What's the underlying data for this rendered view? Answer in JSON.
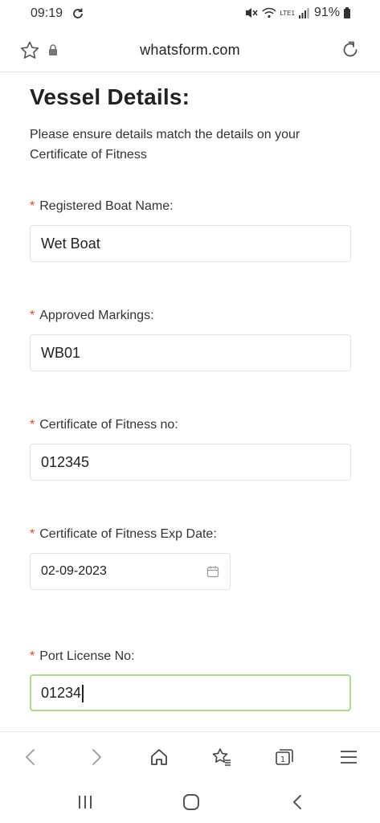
{
  "status_bar": {
    "time": "09:19",
    "battery_percent": "91%",
    "network_label": "LTE1",
    "icons": [
      "sync-icon",
      "mute-icon",
      "wifi-icon",
      "signal-icon",
      "battery-icon"
    ]
  },
  "browser": {
    "url": "whatsform.com",
    "icons": [
      "star-icon",
      "lock-icon",
      "reload-icon"
    ]
  },
  "form": {
    "title": "Vessel Details:",
    "description": "Please ensure details match the details on your Certificate of Fitness",
    "required_mark": "*",
    "fields": [
      {
        "label": "Registered Boat Name:",
        "value": "Wet Boat"
      },
      {
        "label": "Approved Markings:",
        "value": "WB01"
      },
      {
        "label": "Certificate of Fitness no:",
        "value": "012345"
      },
      {
        "label": "Certificate of Fitness Exp Date:",
        "value": "02-09-2023"
      },
      {
        "label": "Port License No:",
        "value": "01234"
      }
    ]
  },
  "browser_nav": {
    "items": [
      "back-icon",
      "forward-icon",
      "home-icon",
      "bookmarks-icon",
      "tabs-icon",
      "menu-icon"
    ],
    "tab_count": "1"
  },
  "system_nav": {
    "items": [
      "recent-apps-icon",
      "home-button-icon",
      "system-back-icon"
    ]
  },
  "colors": {
    "required": "#e0442c",
    "focus_border": "#a9dc8a",
    "input_border": "#e3e3e3"
  }
}
